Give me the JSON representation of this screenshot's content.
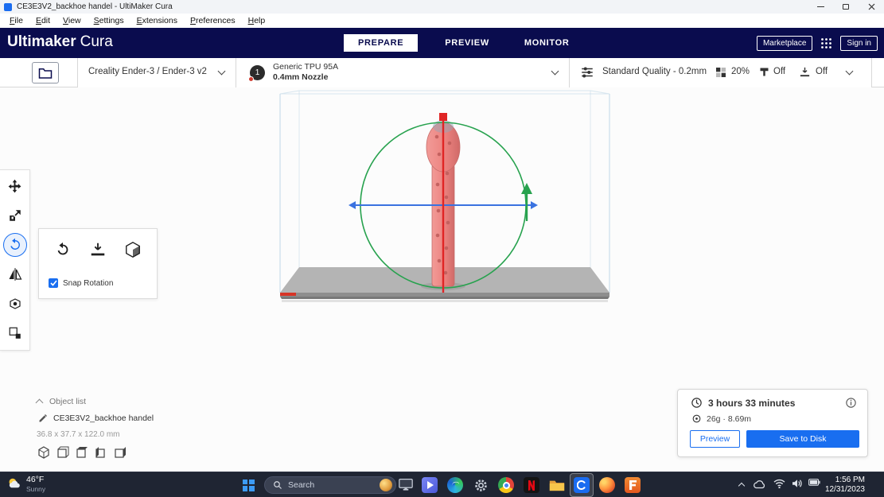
{
  "colors": {
    "header_bg": "#0a0c4e",
    "accent_blue": "#196ef0",
    "taskbar_bg": "#1f2533",
    "model_pink": "#ec8380",
    "gizmo_green": "#27a24e",
    "gizmo_blue": "#3a72e0",
    "gizmo_red": "#e02525"
  },
  "titlebar": {
    "title": "CE3E3V2_backhoe handel - UltiMaker Cura"
  },
  "menubar": {
    "items": [
      "File",
      "Edit",
      "View",
      "Settings",
      "Extensions",
      "Preferences",
      "Help"
    ]
  },
  "header": {
    "brand_bold": "Ultimaker",
    "brand_light": "Cura",
    "tab_prepare": "PREPARE",
    "tab_preview": "PREVIEW",
    "tab_monitor": "MONITOR",
    "marketplace_label": "Marketplace",
    "signin_label": "Sign in"
  },
  "configbar": {
    "printer_name": "Creality Ender-3 / Ender-3 v2",
    "extruder_number": "1",
    "material_name": "Generic TPU 95A",
    "nozzle_size": "0.4mm Nozzle",
    "profile_label": "Standard Quality - 0.2mm",
    "infill_value": "20%",
    "support_value": "Off",
    "adhesion_value": "Off"
  },
  "rotate_panel": {
    "snap_rotation_label": "Snap Rotation"
  },
  "object_list": {
    "toggle_label": "Object list",
    "item_name": "CE3E3V2_backhoe handel",
    "dimensions": "36.8 x 37.7 x 122.0 mm"
  },
  "print_summary": {
    "time_estimate": "3 hours 33 minutes",
    "material_estimate": "26g · 8.69m",
    "preview_button": "Preview",
    "save_button": "Save to Disk"
  },
  "taskbar": {
    "weather_temp": "46°F",
    "weather_condition": "Sunny",
    "search_placeholder": "Search",
    "clock_time": "1:56 PM",
    "clock_date": "12/31/2023",
    "pinned_apps": [
      "monitor-app",
      "media-app",
      "edge",
      "settings",
      "chrome",
      "netflix",
      "file-explorer",
      "cura",
      "firefox",
      "f-app"
    ],
    "tray_icons": [
      "hidden-icons",
      "onedrive",
      "wifi",
      "volume",
      "battery"
    ]
  },
  "icons": {
    "left_toolbar": [
      "move",
      "scale",
      "rotate",
      "mirror",
      "per-model-settings",
      "support-blocker"
    ],
    "rotate_panel": [
      "reset-rotation",
      "lay-flat",
      "select-face"
    ],
    "config_bar": [
      "open-file",
      "extruder",
      "print-settings",
      "infill",
      "support",
      "adhesion"
    ],
    "view_presets": [
      "view-3d",
      "view-front",
      "view-top",
      "view-left",
      "view-right"
    ]
  }
}
